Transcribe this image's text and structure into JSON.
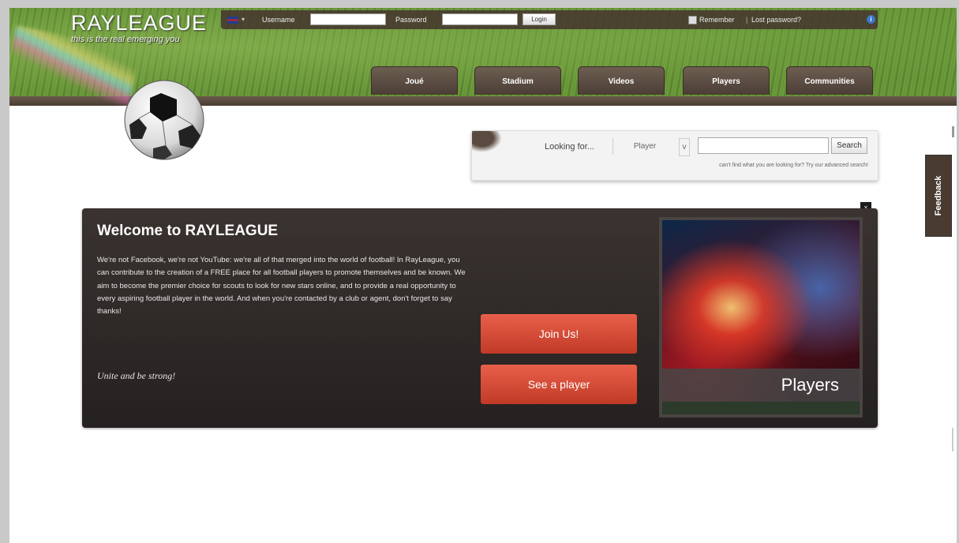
{
  "header": {
    "logo": "RAYLEAGUE",
    "tagline": "this is the real emerging you",
    "login": {
      "language_icon": "uk-flag-icon",
      "username_label": "Username",
      "password_label": "Password",
      "login_label": "Login",
      "remember_label": "Remember",
      "separator": "|",
      "lost_password": "Lost password?",
      "info_icon": "i"
    },
    "tabs": [
      "Joué",
      "Stadium",
      "Videos",
      "Players",
      "Communities"
    ]
  },
  "search": {
    "label": "Looking for...",
    "category": "Player",
    "caret": "v",
    "button": "Search",
    "advanced_text": "can't find what you are looking for? Try our advanced search!"
  },
  "feedback": {
    "label": "Feedback"
  },
  "welcome": {
    "close": "x",
    "title": "Welcome to RAYLEAGUE",
    "body": "We're not Facebook, we're not YouTube: we're all of that merged into the world of football! In RayLeague, you can contribute to the creation of a FREE place for all football players to promote themselves and be known. We aim to become the premier choice for scouts to look for new stars online, and to provide a real opportunity to every aspiring football player in the world. And when you're contacted by a club or agent, don't forget to say thanks!",
    "motto": "Unite and be strong!",
    "join_button": "Join Us!",
    "see_button": "See a player",
    "promo_label": "Players"
  },
  "colors": {
    "header_brown": "#4a3c32",
    "cta_red": "#d94a36",
    "panel_dark": "#2e2826"
  }
}
